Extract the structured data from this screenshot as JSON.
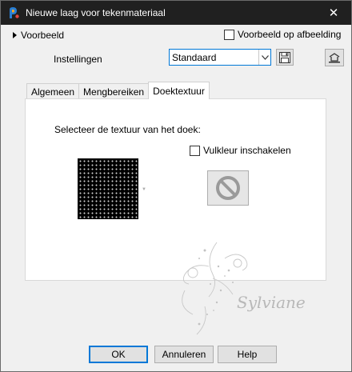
{
  "window": {
    "title": "Nieuwe laag voor tekenmateriaal",
    "close_glyph": "✕"
  },
  "preview": {
    "label": "Voorbeeld",
    "on_image_label": "Voorbeeld op afbeelding",
    "on_image_checked": false
  },
  "settings": {
    "label": "Instellingen",
    "preset_value": "Standaard"
  },
  "tabs": [
    {
      "label": "Algemeen",
      "active": false
    },
    {
      "label": "Mengbereiken",
      "active": false
    },
    {
      "label": "Doektextuur",
      "active": true
    }
  ],
  "canvas_texture": {
    "select_label": "Selecteer de textuur van het doek:",
    "fill_color_label": "Vulkleur inschakelen",
    "fill_color_checked": false
  },
  "watermark_text": "Sylviane",
  "buttons": {
    "ok": "OK",
    "cancel": "Annuleren",
    "help": "Help"
  },
  "colors": {
    "titlebar": "#202020",
    "accent": "#0078d7",
    "dialog_bg": "#f0f0f0"
  }
}
